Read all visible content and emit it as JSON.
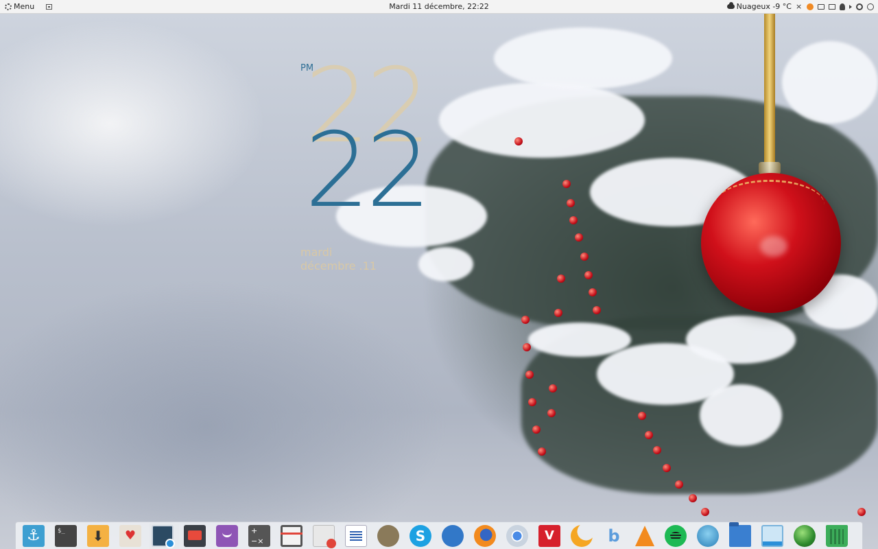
{
  "top_panel": {
    "menu_label": "Menu",
    "datetime": "Mardi 11 décembre, 22:22",
    "weather": "Nuageux -9 °C",
    "tray_icons": [
      "close-icon",
      "notification-icon",
      "mail-icon",
      "display-icon",
      "user-icon",
      "volume-icon",
      "power-icon",
      "user-account-icon"
    ]
  },
  "clock_widget": {
    "ampm": "PM",
    "hour_ghost": "22",
    "hour": "22",
    "day_name": "mardi",
    "month_day": "décembre .11"
  },
  "dock": {
    "items": [
      {
        "name": "anchor-app-icon",
        "glyph": "⚓"
      },
      {
        "name": "terminal-icon",
        "glyph": "$_"
      },
      {
        "name": "download-icon",
        "glyph": "⬇"
      },
      {
        "name": "solitaire-icon",
        "glyph": "♥"
      },
      {
        "name": "screenshot-icon",
        "glyph": ""
      },
      {
        "name": "screen-recorder-icon",
        "glyph": ""
      },
      {
        "name": "face-app-icon",
        "glyph": ""
      },
      {
        "name": "calculator-icon",
        "glyph": "+−×"
      },
      {
        "name": "crop-tool-icon",
        "glyph": ""
      },
      {
        "name": "text-editor-icon",
        "glyph": ""
      },
      {
        "name": "document-writer-icon",
        "glyph": ""
      },
      {
        "name": "gimp-icon",
        "glyph": ""
      },
      {
        "name": "skype-icon",
        "glyph": "S"
      },
      {
        "name": "thunderbird-icon",
        "glyph": ""
      },
      {
        "name": "firefox-icon",
        "glyph": ""
      },
      {
        "name": "chrome-icon",
        "glyph": ""
      },
      {
        "name": "vivaldi-icon",
        "glyph": "V"
      },
      {
        "name": "moon-app-icon",
        "glyph": ""
      },
      {
        "name": "b-app-icon",
        "glyph": "b"
      },
      {
        "name": "vlc-icon",
        "glyph": ""
      },
      {
        "name": "spotify-icon",
        "glyph": ""
      },
      {
        "name": "audio-app-icon",
        "glyph": ""
      },
      {
        "name": "file-manager-icon",
        "glyph": ""
      },
      {
        "name": "window-app-icon",
        "glyph": ""
      },
      {
        "name": "globe-app-icon",
        "glyph": ""
      },
      {
        "name": "trash-icon",
        "glyph": ""
      }
    ]
  },
  "colors": {
    "clock_blue": "#2c6f95",
    "clock_beige": "#d8c8a6",
    "ornament_red": "#d0101a",
    "panel_bg": "#f3f3f3"
  }
}
